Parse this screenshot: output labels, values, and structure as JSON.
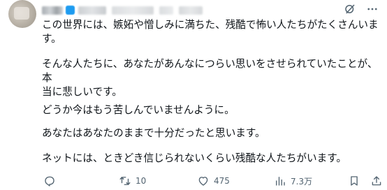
{
  "post": {
    "paragraphs": [
      "この世界には、嫉妬や憎しみに満ちた、残酷で怖い人たちがたくさんいます。",
      "そんな人たちに、あなたがあんなにつらい思いをさせられていたことが、本\n当に悲しいです。",
      "どうか今はもう苦しんでいませんように。",
      "あなたはあなたのままで十分だったと思います。",
      "ネットには、ときどき信じられないくらい残酷な人たちがいます。"
    ]
  },
  "header": {
    "icons": [
      "grok-icon",
      "more-icon"
    ]
  },
  "actions": {
    "reply_count": "",
    "retweet_count": "10",
    "like_count": "475",
    "views_count": "7.3万"
  },
  "colors": {
    "text": "#0f1419",
    "muted": "#536471",
    "accent": "#1d9bf0"
  }
}
